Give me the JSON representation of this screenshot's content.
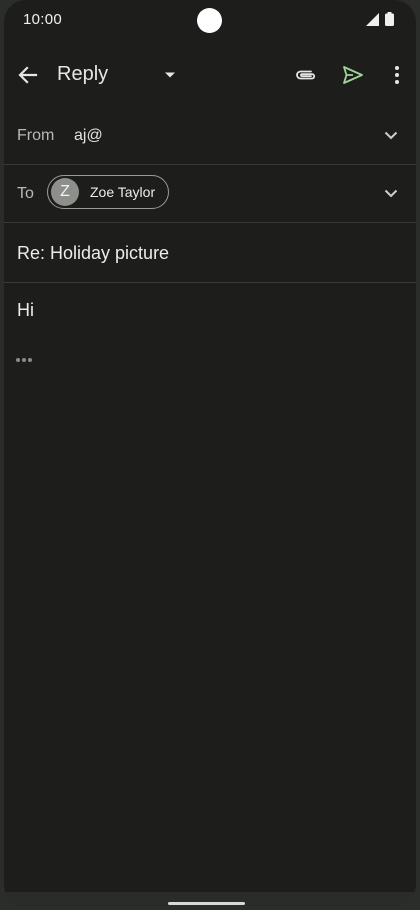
{
  "status_bar": {
    "time": "10:00"
  },
  "app_bar": {
    "title": "Reply",
    "back_icon": "arrow-back-icon",
    "dropdown_icon": "arrow-drop-down-icon",
    "attach_icon": "paperclip-icon",
    "send_icon": "send-icon",
    "more_icon": "more-vert-icon"
  },
  "compose": {
    "from_label": "From",
    "from_value": "aj@",
    "to_label": "To",
    "recipient": {
      "initial": "Z",
      "name": "Zoe Taylor"
    },
    "subject": "Re: Holiday picture",
    "body": "Hi"
  },
  "colors": {
    "background": "#1d1e1c",
    "send_accent": "#9fd49a",
    "divider": "#383a38"
  }
}
